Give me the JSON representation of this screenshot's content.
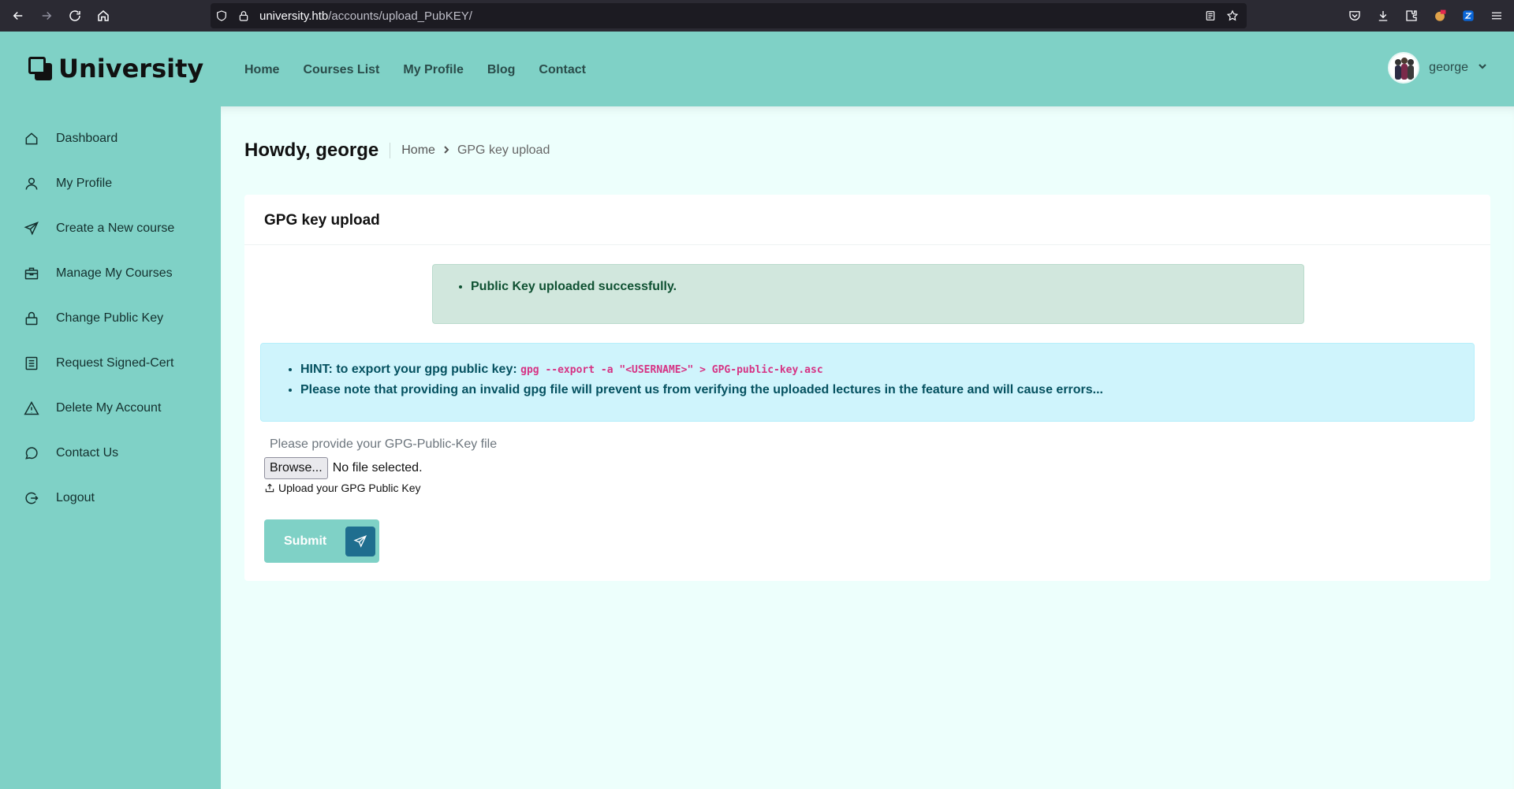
{
  "browser": {
    "url_host": "university.htb",
    "url_path": "/accounts/upload_PubKEY/"
  },
  "header": {
    "brand": "University",
    "nav": [
      "Home",
      "Courses List",
      "My Profile",
      "Blog",
      "Contact"
    ],
    "username": "george"
  },
  "sidebar": {
    "items": [
      {
        "label": "Dashboard",
        "icon": "home-icon"
      },
      {
        "label": "My Profile",
        "icon": "user-icon"
      },
      {
        "label": "Create a New course",
        "icon": "send-icon"
      },
      {
        "label": "Manage My Courses",
        "icon": "briefcase-icon"
      },
      {
        "label": "Change Public Key",
        "icon": "lock-icon"
      },
      {
        "label": "Request Signed-Cert",
        "icon": "document-icon"
      },
      {
        "label": "Delete My Account",
        "icon": "warning-icon"
      },
      {
        "label": "Contact Us",
        "icon": "chat-icon"
      },
      {
        "label": "Logout",
        "icon": "logout-icon"
      }
    ]
  },
  "page": {
    "greeting": "Howdy, george",
    "breadcrumb_home": "Home",
    "breadcrumb_current": "GPG key upload"
  },
  "card": {
    "title": "GPG key upload",
    "success_message": "Public Key uploaded successfully.",
    "hint_prefix": "HINT: to export your gpg public key:",
    "hint_command": "gpg --export -a \"<USERNAME>\" > GPG-public-key.asc",
    "note": "Please note that providing an invalid gpg file will prevent us from verifying the uploaded lectures in the feature and will cause errors...",
    "file_label": "Please provide your GPG-Public-Key file",
    "browse_label": "Browse...",
    "file_status": "No file selected.",
    "upload_hint": "Upload your GPG Public Key",
    "submit_label": "Submit"
  },
  "colors": {
    "teal": "#7fd1c6",
    "background": "#edfffc",
    "submit_icon_bg": "#1f6e8f"
  }
}
